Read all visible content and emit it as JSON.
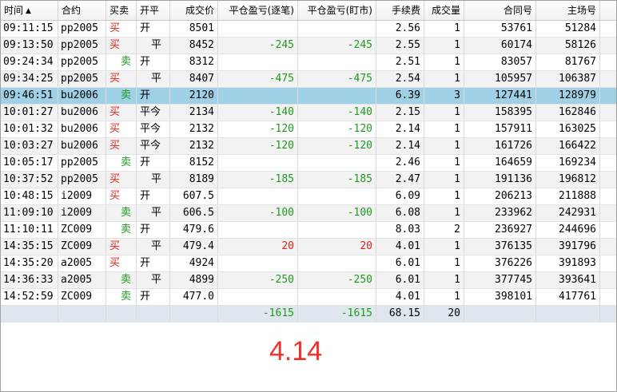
{
  "columns": [
    "时间",
    "合约",
    "买卖",
    "开平",
    "成交价",
    "平仓盈亏(逐笔)",
    "平仓盈亏(盯市)",
    "手续费",
    "成交量",
    "合同号",
    "主场号"
  ],
  "sort_indicator": "▲",
  "trades": [
    {
      "time": "09:11:15",
      "contract": "pp2005",
      "side": "买",
      "oc": "开",
      "price": "8501",
      "pnl_trade": "",
      "pnl_mtm": "",
      "fee": "2.56",
      "qty": "1",
      "contract_no": "53761",
      "exch_no": "51284"
    },
    {
      "time": "09:13:50",
      "contract": "pp2005",
      "side": "买",
      "oc": "平",
      "price": "8452",
      "pnl_trade": "-245",
      "pnl_mtm": "-245",
      "fee": "2.55",
      "qty": "1",
      "contract_no": "60174",
      "exch_no": "58126"
    },
    {
      "time": "09:24:34",
      "contract": "pp2005",
      "side": "卖",
      "oc": "开",
      "price": "8312",
      "pnl_trade": "",
      "pnl_mtm": "",
      "fee": "2.51",
      "qty": "1",
      "contract_no": "83057",
      "exch_no": "81767"
    },
    {
      "time": "09:34:25",
      "contract": "pp2005",
      "side": "买",
      "oc": "平",
      "price": "8407",
      "pnl_trade": "-475",
      "pnl_mtm": "-475",
      "fee": "2.54",
      "qty": "1",
      "contract_no": "105957",
      "exch_no": "106387"
    },
    {
      "time": "09:46:51",
      "contract": "bu2006",
      "side": "卖",
      "oc": "开",
      "price": "2120",
      "pnl_trade": "",
      "pnl_mtm": "",
      "fee": "6.39",
      "qty": "3",
      "contract_no": "127441",
      "exch_no": "128979"
    },
    {
      "time": "10:01:27",
      "contract": "bu2006",
      "side": "买",
      "oc": "平今",
      "price": "2134",
      "pnl_trade": "-140",
      "pnl_mtm": "-140",
      "fee": "2.15",
      "qty": "1",
      "contract_no": "158395",
      "exch_no": "162846"
    },
    {
      "time": "10:01:32",
      "contract": "bu2006",
      "side": "买",
      "oc": "平今",
      "price": "2132",
      "pnl_trade": "-120",
      "pnl_mtm": "-120",
      "fee": "2.14",
      "qty": "1",
      "contract_no": "157911",
      "exch_no": "163025"
    },
    {
      "time": "10:03:27",
      "contract": "bu2006",
      "side": "买",
      "oc": "平今",
      "price": "2132",
      "pnl_trade": "-120",
      "pnl_mtm": "-120",
      "fee": "2.14",
      "qty": "1",
      "contract_no": "161726",
      "exch_no": "166422"
    },
    {
      "time": "10:05:17",
      "contract": "pp2005",
      "side": "卖",
      "oc": "开",
      "price": "8152",
      "pnl_trade": "",
      "pnl_mtm": "",
      "fee": "2.46",
      "qty": "1",
      "contract_no": "164659",
      "exch_no": "169234"
    },
    {
      "time": "10:37:52",
      "contract": "pp2005",
      "side": "买",
      "oc": "平",
      "price": "8189",
      "pnl_trade": "-185",
      "pnl_mtm": "-185",
      "fee": "2.47",
      "qty": "1",
      "contract_no": "191136",
      "exch_no": "196812"
    },
    {
      "time": "10:48:15",
      "contract": "i2009",
      "side": "买",
      "oc": "开",
      "price": "607.5",
      "pnl_trade": "",
      "pnl_mtm": "",
      "fee": "6.09",
      "qty": "1",
      "contract_no": "206213",
      "exch_no": "211888"
    },
    {
      "time": "11:09:10",
      "contract": "i2009",
      "side": "卖",
      "oc": "平",
      "price": "606.5",
      "pnl_trade": "-100",
      "pnl_mtm": "-100",
      "fee": "6.08",
      "qty": "1",
      "contract_no": "233962",
      "exch_no": "242931"
    },
    {
      "time": "11:10:11",
      "contract": "ZC009",
      "side": "卖",
      "oc": "开",
      "price": "479.6",
      "pnl_trade": "",
      "pnl_mtm": "",
      "fee": "8.03",
      "qty": "2",
      "contract_no": "236927",
      "exch_no": "244696"
    },
    {
      "time": "14:35:15",
      "contract": "ZC009",
      "side": "买",
      "oc": "平",
      "price": "479.4",
      "pnl_trade": "20",
      "pnl_mtm": "20",
      "fee": "4.01",
      "qty": "1",
      "contract_no": "376135",
      "exch_no": "391796"
    },
    {
      "time": "14:35:20",
      "contract": "a2005",
      "side": "买",
      "oc": "开",
      "price": "4924",
      "pnl_trade": "",
      "pnl_mtm": "",
      "fee": "6.01",
      "qty": "1",
      "contract_no": "376226",
      "exch_no": "391893"
    },
    {
      "time": "14:36:33",
      "contract": "a2005",
      "side": "卖",
      "oc": "平",
      "price": "4899",
      "pnl_trade": "-250",
      "pnl_mtm": "-250",
      "fee": "6.01",
      "qty": "1",
      "contract_no": "377745",
      "exch_no": "393641"
    },
    {
      "time": "14:52:59",
      "contract": "ZC009",
      "side": "卖",
      "oc": "开",
      "price": "477.0",
      "pnl_trade": "",
      "pnl_mtm": "",
      "fee": "4.01",
      "qty": "1",
      "contract_no": "398101",
      "exch_no": "417761"
    }
  ],
  "selected_row": 4,
  "totals": {
    "pnl_trade": "-1615",
    "pnl_mtm": "-1615",
    "fee": "68.15",
    "qty": "20"
  },
  "overlay_text": "4.14",
  "colors": {
    "buy": "#e4221b",
    "sell": "#1f9a1f",
    "loss": "#1f9a1f",
    "profit": "#e4221b",
    "selected": "#9fd0e6",
    "overlay": "#f03028"
  }
}
